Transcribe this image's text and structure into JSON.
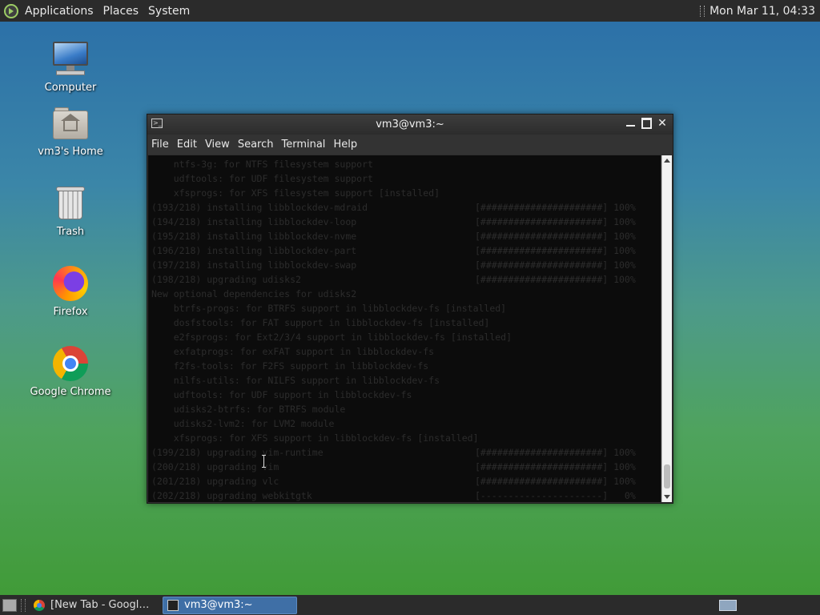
{
  "top_panel": {
    "menus": [
      "Applications",
      "Places",
      "System"
    ],
    "clock": "Mon Mar 11, 04:33"
  },
  "desktop_icons": [
    {
      "label": "Computer",
      "icon": "computer-icon"
    },
    {
      "label": "vm3's Home",
      "icon": "home-folder-icon"
    },
    {
      "label": "Trash",
      "icon": "trash-icon"
    },
    {
      "label": "Firefox",
      "icon": "firefox-icon"
    },
    {
      "label": "Google Chrome",
      "icon": "chrome-icon"
    }
  ],
  "terminal": {
    "title": "vm3@vm3:~",
    "menus": [
      "File",
      "Edit",
      "View",
      "Search",
      "Terminal",
      "Help"
    ],
    "lines": [
      {
        "text": "    ntfs-3g: for NTFS filesystem support",
        "bar": ""
      },
      {
        "text": "    udftools: for UDF filesystem support",
        "bar": ""
      },
      {
        "text": "    xfsprogs: for XFS filesystem support [installed]",
        "bar": ""
      },
      {
        "text": "(193/218) installing libblockdev-mdraid",
        "bar": "[######################] 100%"
      },
      {
        "text": "(194/218) installing libblockdev-loop",
        "bar": "[######################] 100%"
      },
      {
        "text": "(195/218) installing libblockdev-nvme",
        "bar": "[######################] 100%"
      },
      {
        "text": "(196/218) installing libblockdev-part",
        "bar": "[######################] 100%"
      },
      {
        "text": "(197/218) installing libblockdev-swap",
        "bar": "[######################] 100%"
      },
      {
        "text": "(198/218) upgrading udisks2",
        "bar": "[######################] 100%"
      },
      {
        "text": "New optional dependencies for udisks2",
        "bar": ""
      },
      {
        "text": "    btrfs-progs: for BTRFS support in libblockdev-fs [installed]",
        "bar": ""
      },
      {
        "text": "    dosfstools: for FAT support in libblockdev-fs [installed]",
        "bar": ""
      },
      {
        "text": "    e2fsprogs: for Ext2/3/4 support in libblockdev-fs [installed]",
        "bar": ""
      },
      {
        "text": "    exfatprogs: for exFAT support in libblockdev-fs",
        "bar": ""
      },
      {
        "text": "    f2fs-tools: for F2FS support in libblockdev-fs",
        "bar": ""
      },
      {
        "text": "    nilfs-utils: for NILFS support in libblockdev-fs",
        "bar": ""
      },
      {
        "text": "    udftools: for UDF support in libblockdev-fs",
        "bar": ""
      },
      {
        "text": "    udisks2-btrfs: for BTRFS module",
        "bar": ""
      },
      {
        "text": "    udisks2-lvm2: for LVM2 module",
        "bar": ""
      },
      {
        "text": "    xfsprogs: for XFS support in libblockdev-fs [installed]",
        "bar": ""
      },
      {
        "text": "(199/218) upgrading vim-runtime",
        "bar": "[######################] 100%"
      },
      {
        "text": "(200/218) upgrading vim",
        "bar": "[######################] 100%"
      },
      {
        "text": "(201/218) upgrading vlc",
        "bar": "[######################] 100%"
      },
      {
        "text": "(202/218) upgrading webkitgtk",
        "bar": "[----------------------]   0%"
      }
    ]
  },
  "taskbar": {
    "tasks": [
      {
        "label": "[New Tab - Google ...",
        "icon": "chrome-icon",
        "active": false
      },
      {
        "label": "vm3@vm3:~",
        "icon": "terminal-icon",
        "active": true
      }
    ]
  }
}
